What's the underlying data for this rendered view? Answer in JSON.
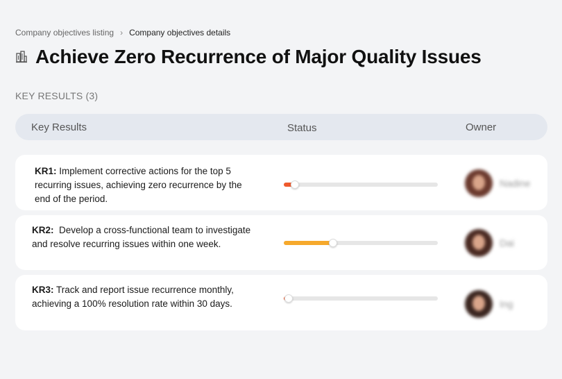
{
  "breadcrumb": {
    "parent": "Company objectives listing",
    "separator": "›",
    "current": "Company objectives details"
  },
  "page": {
    "title": "Achieve Zero Recurrence of Major Quality Issues",
    "icon": "building-icon"
  },
  "key_results_section": {
    "label": "KEY RESULTS (3)"
  },
  "table": {
    "columns": {
      "key_results": "Key Results",
      "status": "Status",
      "owner": "Owner"
    },
    "rows": [
      {
        "code": "KR1:",
        "text": " Implement corrective actions for the top 5 recurring issues, achieving zero recurrence by the end of the period.",
        "progress": 0.07,
        "progress_color": "#ef5a2d",
        "owner": "Nadine",
        "avatar_bg": "#6b3a2e"
      },
      {
        "code": "KR2:",
        "text": "  Develop a cross-functional team to investigate and resolve recurring issues within one week.",
        "progress": 0.32,
        "progress_color": "#f6a92c",
        "owner": "Dai",
        "avatar_bg": "#4a2a22"
      },
      {
        "code": "KR3:",
        "text": " Track and report issue recurrence monthly, achieving a 100% resolution rate within 30 days.",
        "progress": 0.03,
        "progress_color": "#ef5a2d",
        "owner": "Ing",
        "avatar_bg": "#3b2620"
      }
    ]
  }
}
